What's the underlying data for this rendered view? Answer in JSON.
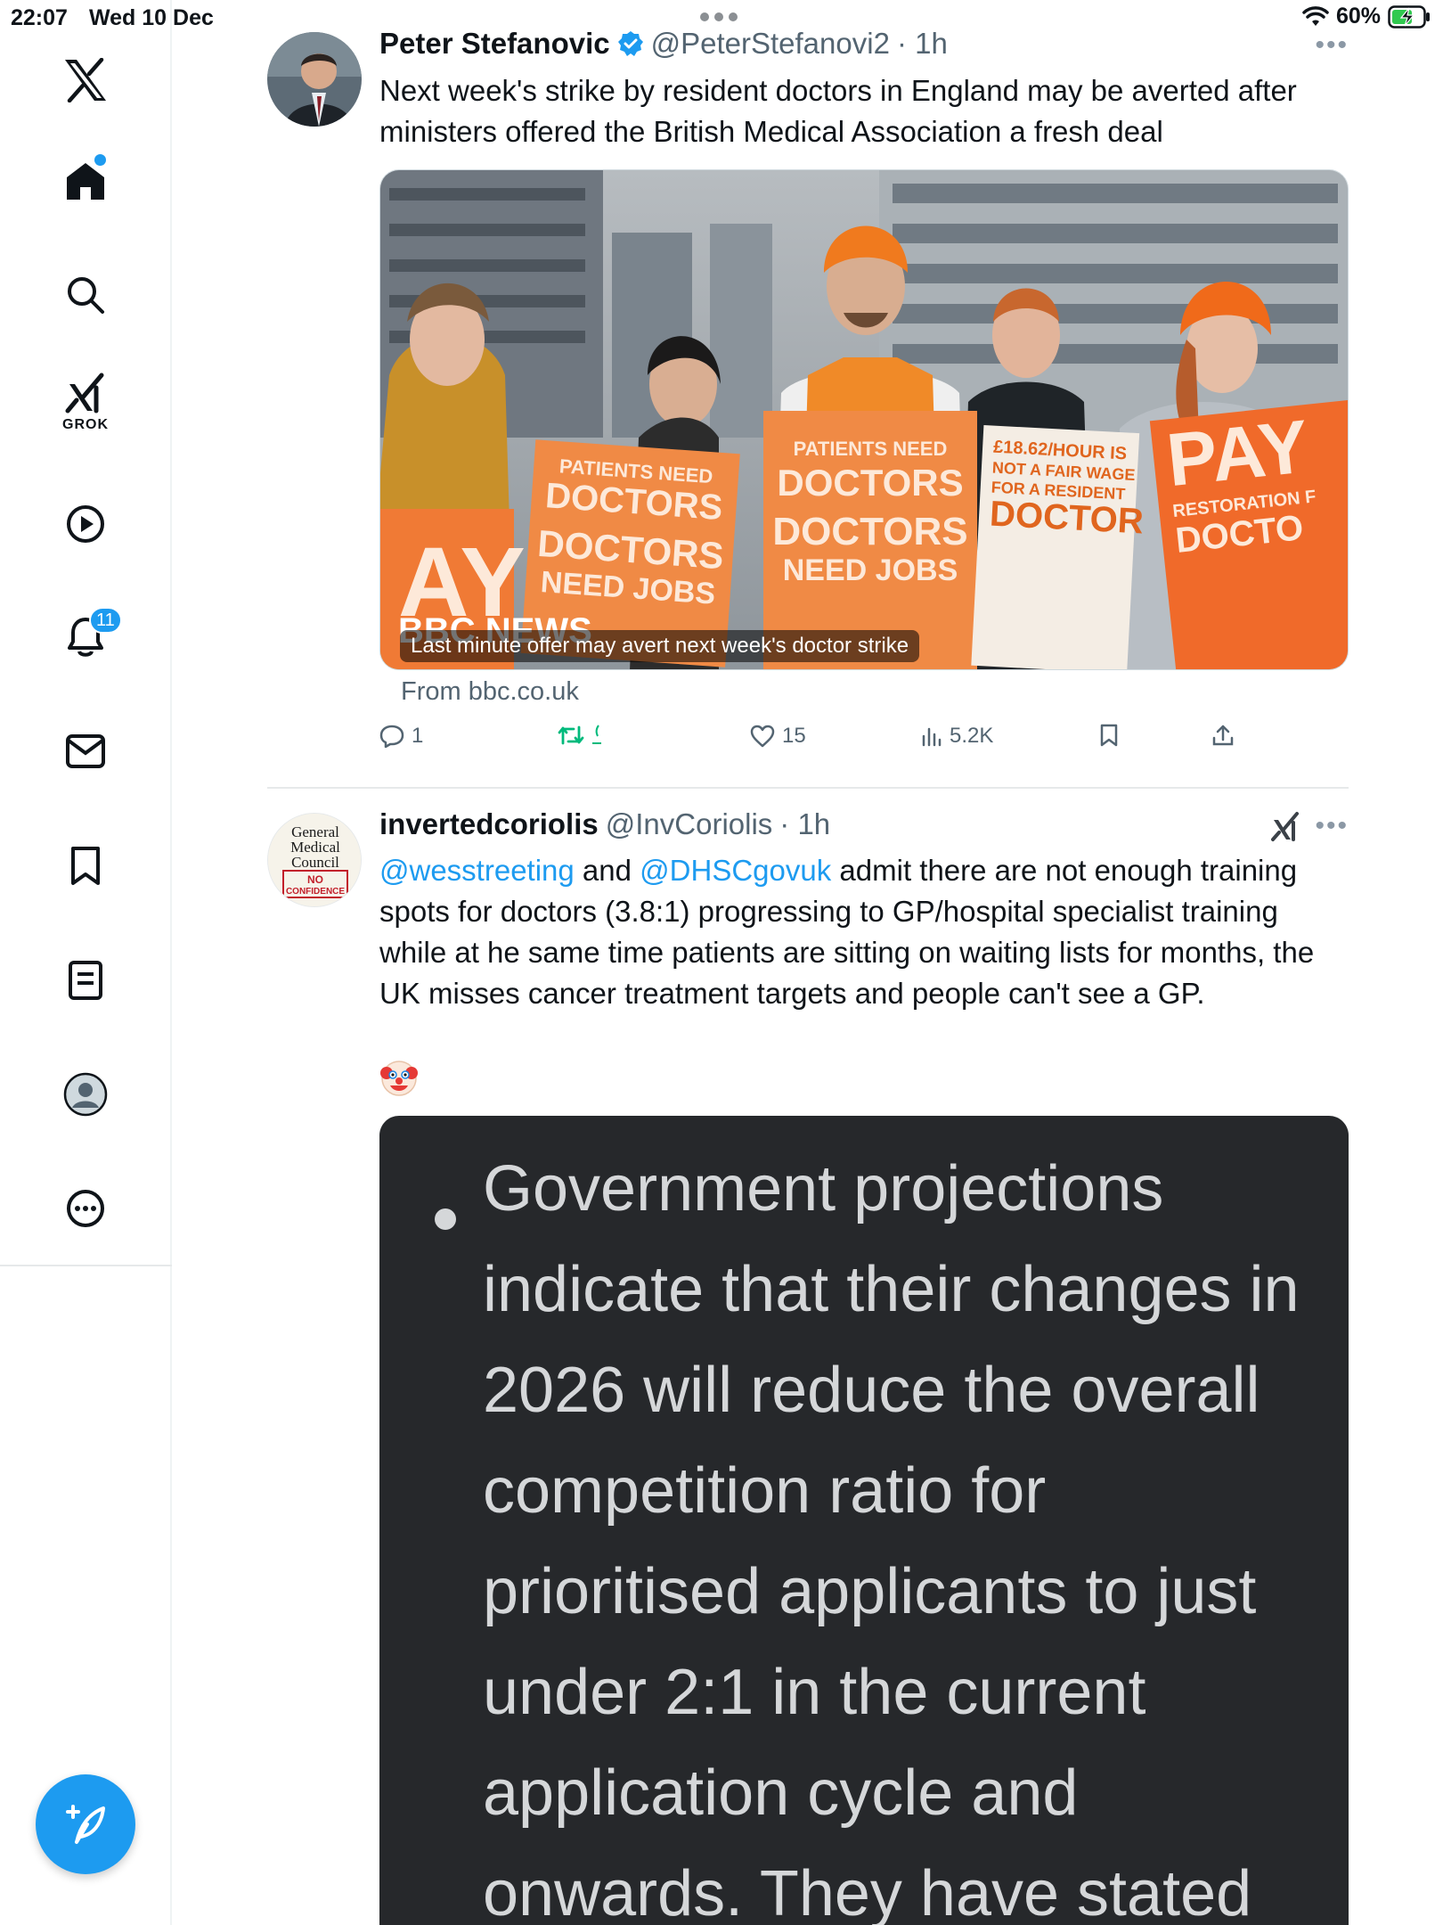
{
  "status_bar": {
    "time": "22:07",
    "date": "Wed 10 Dec",
    "battery": "60%"
  },
  "sidebar": {
    "items": [
      {
        "name": "x-logo-icon",
        "label": ""
      },
      {
        "name": "home-icon",
        "label": ""
      },
      {
        "name": "search-icon",
        "label": ""
      },
      {
        "name": "grok-icon",
        "label": "GROK"
      },
      {
        "name": "video-play-icon",
        "label": ""
      },
      {
        "name": "notifications-bell-icon",
        "label": "",
        "badge": "11"
      },
      {
        "name": "messages-envelope-icon",
        "label": ""
      },
      {
        "name": "bookmarks-icon",
        "label": ""
      },
      {
        "name": "lists-icon",
        "label": ""
      },
      {
        "name": "profile-icon",
        "label": ""
      },
      {
        "name": "more-options-icon",
        "label": ""
      }
    ],
    "grok_label": "GROK",
    "notif_badge": "11"
  },
  "tweets": [
    {
      "name": "Peter Stefanovic",
      "handle": "@PeterStefanovi2",
      "time": "· 1h",
      "verified": true,
      "text": "Next week's strike by resident doctors in England may be averted after ministers offered the British Medical Association a fresh deal",
      "media_caption": "Last minute offer may avert next week's doctor strike",
      "media_source": "From bbc.co.uk",
      "actions": {
        "replies": "1",
        "reposts": "",
        "likes": "15",
        "views": "5.2K"
      }
    },
    {
      "name": "invertedcoriolis",
      "handle": "@InvCoriolis",
      "time": "· 1h",
      "text_parts": {
        "mention1": "@wesstreeting",
        "and": " and ",
        "mention2": "@DHSCgovuk",
        "rest": " admit there are not enough training spots for doctors (3.8:1) progressing to GP/hospital specialist training while at he same time patients are sitting on waiting lists for months, the UK misses cancer treatment targets and people can't see a GP."
      },
      "avatar_text": {
        "line1": "General",
        "line2": "Medical",
        "line3": "Council",
        "stamp1": "NO",
        "stamp2": "CONFIDENCE"
      },
      "emoji": "clown-face",
      "quote_text": "Government projections indicate that their changes in 2026 will reduce the overall competition ratio for prioritised applicants to just under 2:1 in the current application cycle and onwards. They have stated"
    }
  ],
  "media_signs": {
    "sign1_top": "PATIENTS NEED",
    "sign1_big": "DOCTORS",
    "sign1_b2": "DOCTORS",
    "sign1_b3": "NEED JOBS",
    "sign2_top": "PATIENTS NEED",
    "sign2_big": "DOCTORS",
    "sign2_b2": "DOCTORS",
    "sign2_b3": "NEED JOBS",
    "sign3_l1": "£18.62/HOUR IS",
    "sign3_l2": "NOT A FAIR WAGE",
    "sign3_l3": "FOR A RESIDENT",
    "sign3_l4": "DOCTOR",
    "sign4_big": "PAY",
    "sign4_l2": "RESTORATION F",
    "sign4_l3": "DOCTO",
    "bbc": "BBC NEWS"
  },
  "colors": {
    "accent": "#1d9bf0",
    "repost_green": "#00ba7c",
    "text_secondary": "#536471",
    "quote_bg": "#26282b",
    "sign_orange": "#f08a45"
  }
}
